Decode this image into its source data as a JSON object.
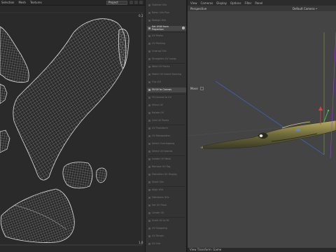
{
  "uv_editor": {
    "menu": [
      "Selection",
      "Mesh",
      "Textures"
    ],
    "projection_value": "Project",
    "corner_top": "0,1",
    "corner_bottom": "1,0"
  },
  "tools": [
    {
      "label": "Optimal UVs",
      "active": false
    },
    {
      "label": "Relax UVs Plus",
      "active": false
    },
    {
      "label": "Realign UVs",
      "active": false
    },
    {
      "label": "Set UVW from Projection",
      "active": true,
      "badge": "i"
    },
    {
      "label": "UV Peeler",
      "active": false
    },
    {
      "label": "UV Packing",
      "active": false
    },
    {
      "label": "Unwrap UVs",
      "active": false
    },
    {
      "label": "Straighten UV Loops",
      "active": false
    },
    {
      "label": "Weld UV Points",
      "active": false
    },
    {
      "label": "Match UV Island Spacing",
      "active": false
    },
    {
      "label": "Flip U/V",
      "active": false
    },
    {
      "label": "Fit UV to Canvas",
      "active": true
    },
    {
      "label": "Fit Canvas to UV",
      "active": false
    },
    {
      "label": "Mirror UV",
      "active": false
    },
    {
      "label": "Rotate UV",
      "active": false
    },
    {
      "label": "Grid UV Points",
      "active": false
    },
    {
      "label": "UV Transform",
      "active": false
    },
    {
      "label": "UV Manipulator",
      "active": false
    },
    {
      "label": "Select Overlapping",
      "active": false
    },
    {
      "label": "Select UV Islands",
      "active": false
    },
    {
      "label": "Isolate UV Mesh",
      "active": false
    },
    {
      "label": "Remove UV Tag",
      "active": false
    },
    {
      "label": "Distortion UV Display",
      "active": false
    },
    {
      "label": "Stack UVs",
      "active": false
    },
    {
      "label": "Align UVs",
      "active": false
    },
    {
      "label": "Distribute UVs",
      "active": false
    },
    {
      "label": "Set UV Pivot",
      "active": false
    },
    {
      "label": "Center UV",
      "active": false
    },
    {
      "label": "Scale UV to Fit",
      "active": false
    },
    {
      "label": "UV Snapping",
      "active": false
    },
    {
      "label": "UV Terrain",
      "active": false
    },
    {
      "label": "UV Info",
      "active": false
    }
  ],
  "viewport": {
    "menu": [
      "View",
      "Cameras",
      "Display",
      "Options",
      "Filter",
      "Panel"
    ],
    "title": "Perspective",
    "camera": "Default Camera •",
    "mode_label": "Move",
    "status": "View Transform: Game"
  }
}
